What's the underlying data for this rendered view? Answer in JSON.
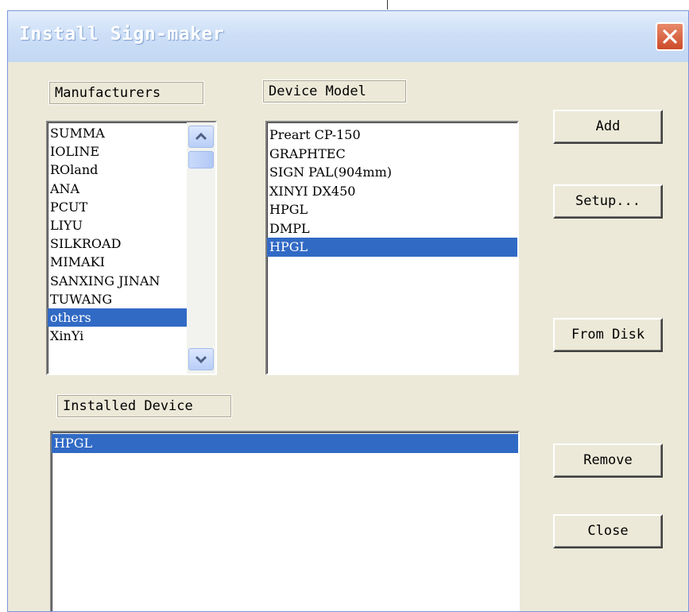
{
  "window": {
    "title": "Install Sign-maker"
  },
  "manufacturers": {
    "label": "Manufacturers",
    "items": [
      "SUMMA",
      "IOLINE",
      "ROland",
      "ANA",
      "PCUT",
      "LIYU",
      "SILKROAD",
      "MIMAKI",
      "SANXING JINAN",
      "TUWANG",
      "others",
      "XinYi"
    ],
    "selected": "others"
  },
  "device_model": {
    "label": "Device Model",
    "items": [
      "Preart CP-150",
      "GRAPHTEC",
      "SIGN PAL(904mm)",
      "XINYI DX450",
      "HPGL",
      "DMPL",
      "HPGL"
    ],
    "selected_index": 6
  },
  "installed_device": {
    "label": "Installed Device",
    "items": [
      "HPGL"
    ],
    "selected_index": 0
  },
  "buttons": {
    "add": "Add",
    "setup": "Setup...",
    "from_disk": "From Disk",
    "remove": "Remove",
    "close": "Close"
  },
  "colors": {
    "selection": "#316ac5",
    "dialog_bg": "#ece9d8",
    "close_button": "#d9542f"
  },
  "icons": {
    "close": "close-icon",
    "scroll_up": "chevron-up-icon",
    "scroll_down": "chevron-down-icon"
  }
}
